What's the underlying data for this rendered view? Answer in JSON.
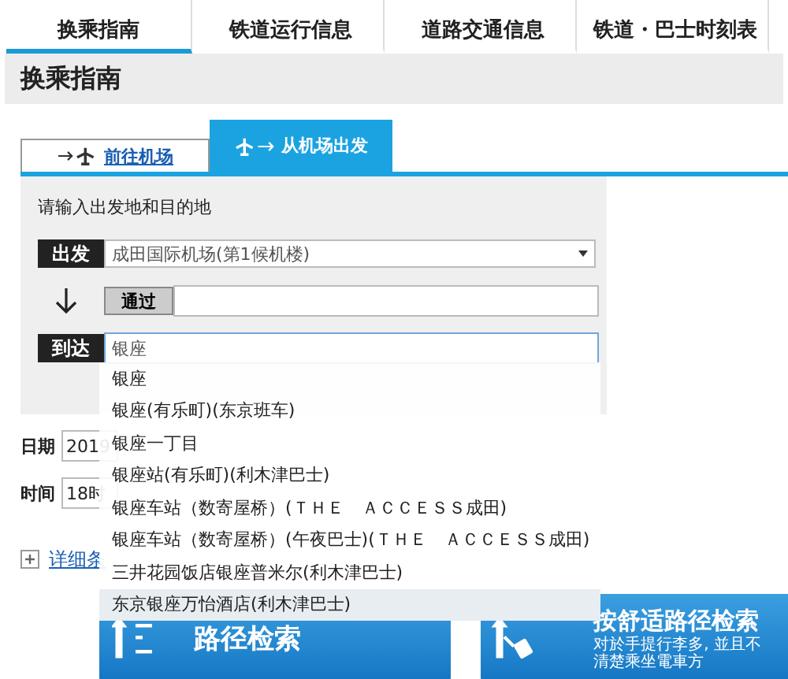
{
  "nav_tabs": [
    {
      "label": "换乘指南",
      "selected": true
    },
    {
      "label": "铁道运行信息",
      "selected": false
    },
    {
      "label": "道路交通信息",
      "selected": false
    },
    {
      "label": "铁道・巴士时刻表",
      "selected": false
    }
  ],
  "page_title": "换乘指南",
  "route_tabs": [
    {
      "kind": "to",
      "label": "前往机场",
      "selected": false
    },
    {
      "kind": "from",
      "label": "从机场出发",
      "selected": true
    }
  ],
  "form": {
    "instruction": "请输入出发地和目的地",
    "departure": {
      "label": "出发",
      "value": "成田国际机场(第1候机楼)"
    },
    "via": {
      "label": "通过"
    },
    "arrival": {
      "label": "到达",
      "value": "银座"
    },
    "date": {
      "label": "日期",
      "value": "2019"
    },
    "time": {
      "label": "时间",
      "value": "18时"
    },
    "details_link": "详细条"
  },
  "suggestions": [
    {
      "label": "银座",
      "selected": false
    },
    {
      "label": "银座(有乐町)(东京班车)",
      "selected": false
    },
    {
      "label": "银座一丁目",
      "selected": false
    },
    {
      "label": "银座站(有乐町)(利木津巴士)",
      "selected": false
    },
    {
      "label": "银座车站（数寄屋桥）(ＴＨＥ　ＡＣＣＥＳＳ成田)",
      "selected": false
    },
    {
      "label": "银座车站（数寄屋桥）(午夜巴士)(ＴＨＥ　ＡＣＣＥＳＳ成田)",
      "selected": false
    },
    {
      "label": "三井花园饭店银座普米尔(利木津巴士)",
      "selected": false
    },
    {
      "label": "东京银座万怡酒店(利木津巴士)",
      "selected": true
    }
  ],
  "buttons": [
    {
      "kind": "route",
      "label": "路径检索"
    },
    {
      "kind": "comfort",
      "label": "按舒适路径检索",
      "note": "对於手提行李多, 並且不清楚乘坐電車方"
    }
  ]
}
